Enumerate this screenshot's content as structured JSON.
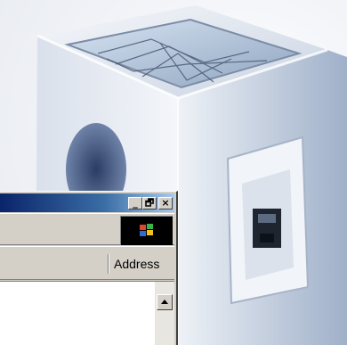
{
  "background": {
    "art": "glass-cube-with-network-jack",
    "colors": {
      "cube_light": "#e9eef6",
      "cube_shadow": "#8c9bb3",
      "hole": "#3b4f7a"
    }
  },
  "window": {
    "caption_buttons": [
      {
        "name": "minimize-icon",
        "glyph": "_"
      },
      {
        "name": "restore-icon",
        "glyph": "🗗"
      },
      {
        "name": "close-icon",
        "glyph": "×"
      }
    ],
    "throbber_icon": "windows-logo-icon",
    "address_label": "Address",
    "colors": {
      "chrome": "#d4d0c8",
      "titlebar": "#0a246a"
    }
  }
}
